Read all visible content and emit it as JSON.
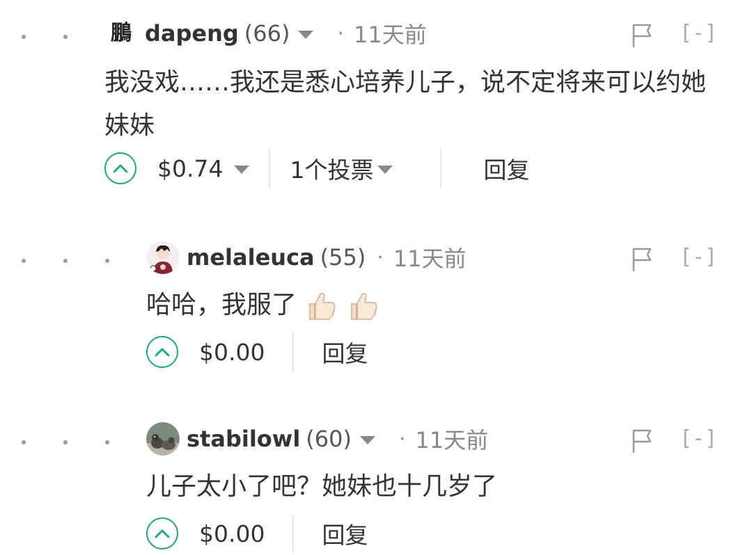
{
  "comments": [
    {
      "avatar_text": "鵬",
      "username": "dapeng",
      "reputation": "(66)",
      "separator": "·",
      "time": "11天前",
      "collapse_label": "[-]",
      "body": "我没戏……我还是悉心培养儿子，说不定将来可以约她妹妹",
      "payout": "$0.74",
      "votes_label": "1个投票",
      "reply_label": "回复"
    },
    {
      "username": "melaleuca",
      "reputation": "(55)",
      "separator": "·",
      "time": "11天前",
      "collapse_label": "[-]",
      "body": "哈哈，我服了",
      "body_emoji": [
        "thumbs-up-icon",
        "thumbs-up-icon"
      ],
      "payout": "$0.00",
      "reply_label": "回复"
    },
    {
      "username": "stabilowl",
      "reputation": "(60)",
      "separator": "·",
      "time": "11天前",
      "collapse_label": "[-]",
      "body": "儿子太小了吧？她妹也十几岁了",
      "payout": "$0.00",
      "reply_label": "回复"
    }
  ],
  "colors": {
    "upvote_accent": "#1aae74",
    "muted_text": "#888888",
    "body_text": "#333333"
  }
}
